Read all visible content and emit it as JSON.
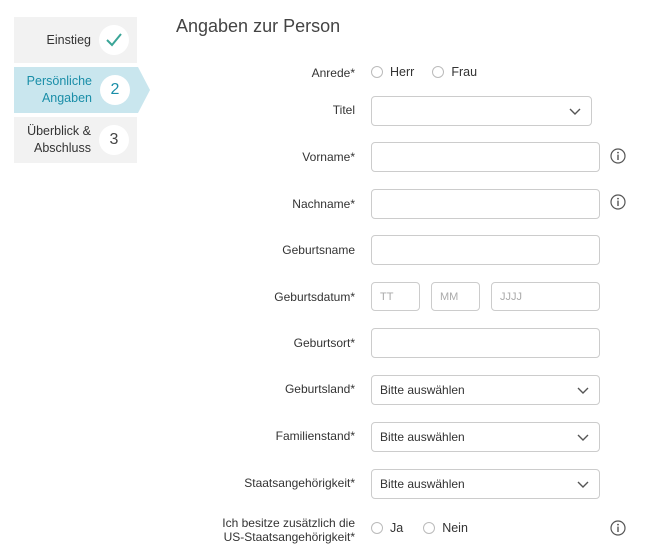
{
  "stepper": {
    "steps": [
      {
        "label_line1": "Einstieg",
        "label_line2": "",
        "marker": "✓",
        "state": "done"
      },
      {
        "label_line1": "Persönliche",
        "label_line2": "Angaben",
        "marker": "2",
        "state": "active"
      },
      {
        "label_line1": "Überblick &",
        "label_line2": "Abschluss",
        "marker": "3",
        "state": "upcoming"
      }
    ]
  },
  "form": {
    "heading": "Angaben zur Person",
    "anrede": {
      "label": "Anrede*",
      "options": [
        "Herr",
        "Frau"
      ]
    },
    "titel": {
      "label": "Titel",
      "value": ""
    },
    "vorname": {
      "label": "Vorname*",
      "value": ""
    },
    "nachname": {
      "label": "Nachname*",
      "value": ""
    },
    "geburtsname": {
      "label": "Geburtsname",
      "value": ""
    },
    "geburtsdatum": {
      "label": "Geburtsdatum*",
      "day_placeholder": "TT",
      "month_placeholder": "MM",
      "year_placeholder": "JJJJ"
    },
    "geburtsort": {
      "label": "Geburtsort*",
      "value": ""
    },
    "geburtsland": {
      "label": "Geburtsland*",
      "value": "Bitte auswählen"
    },
    "familienstand": {
      "label": "Familienstand*",
      "value": "Bitte auswählen"
    },
    "staatsangehoerigkeit": {
      "label": "Staatsangehörigkeit*",
      "value": "Bitte auswählen"
    },
    "us": {
      "label_line1": "Ich besitze zusätzlich die",
      "label_line2": "US-Staatsangehörigkeit*",
      "options": [
        "Ja",
        "Nein"
      ]
    }
  },
  "colors": {
    "accent": "#1a8ea8",
    "accent_bg": "#c9e6ee",
    "check": "#3aa597"
  },
  "icons": {
    "info": "info-circle-icon",
    "chevron": "chevron-down-icon",
    "check": "check-icon"
  }
}
